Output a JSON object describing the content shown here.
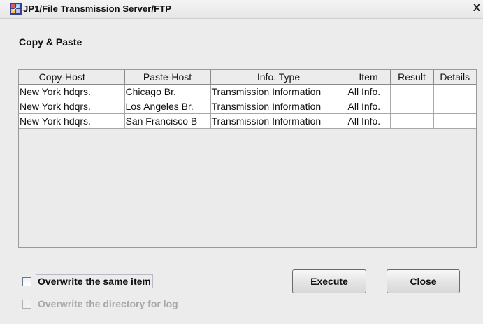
{
  "window": {
    "title": "JP1/File Transmission Server/FTP",
    "close_glyph": "X"
  },
  "section": {
    "title": "Copy & Paste"
  },
  "table": {
    "columns": [
      "Copy-Host",
      "",
      "Paste-Host",
      "Info. Type",
      "Item",
      "Result",
      "Details"
    ],
    "rows": [
      [
        "New York hdqrs.",
        "",
        "Chicago Br.",
        "Transmission Information",
        "All Info.",
        "",
        ""
      ],
      [
        "New York hdqrs.",
        "",
        "Los Angeles Br.",
        "Transmission Information",
        "All Info.",
        "",
        ""
      ],
      [
        "New York hdqrs.",
        "",
        "San Francisco B",
        "Transmission Information",
        "All Info.",
        "",
        ""
      ]
    ]
  },
  "options": {
    "overwrite_same_item": {
      "label": "Overwrite the same item",
      "checked": false,
      "enabled": true
    },
    "overwrite_directory_log": {
      "label": "Overwrite the directory for log",
      "checked": false,
      "enabled": false
    }
  },
  "buttons": {
    "execute": "Execute",
    "close": "Close"
  },
  "icons": {
    "app": "jp1-app-icon",
    "close": "close-icon"
  }
}
